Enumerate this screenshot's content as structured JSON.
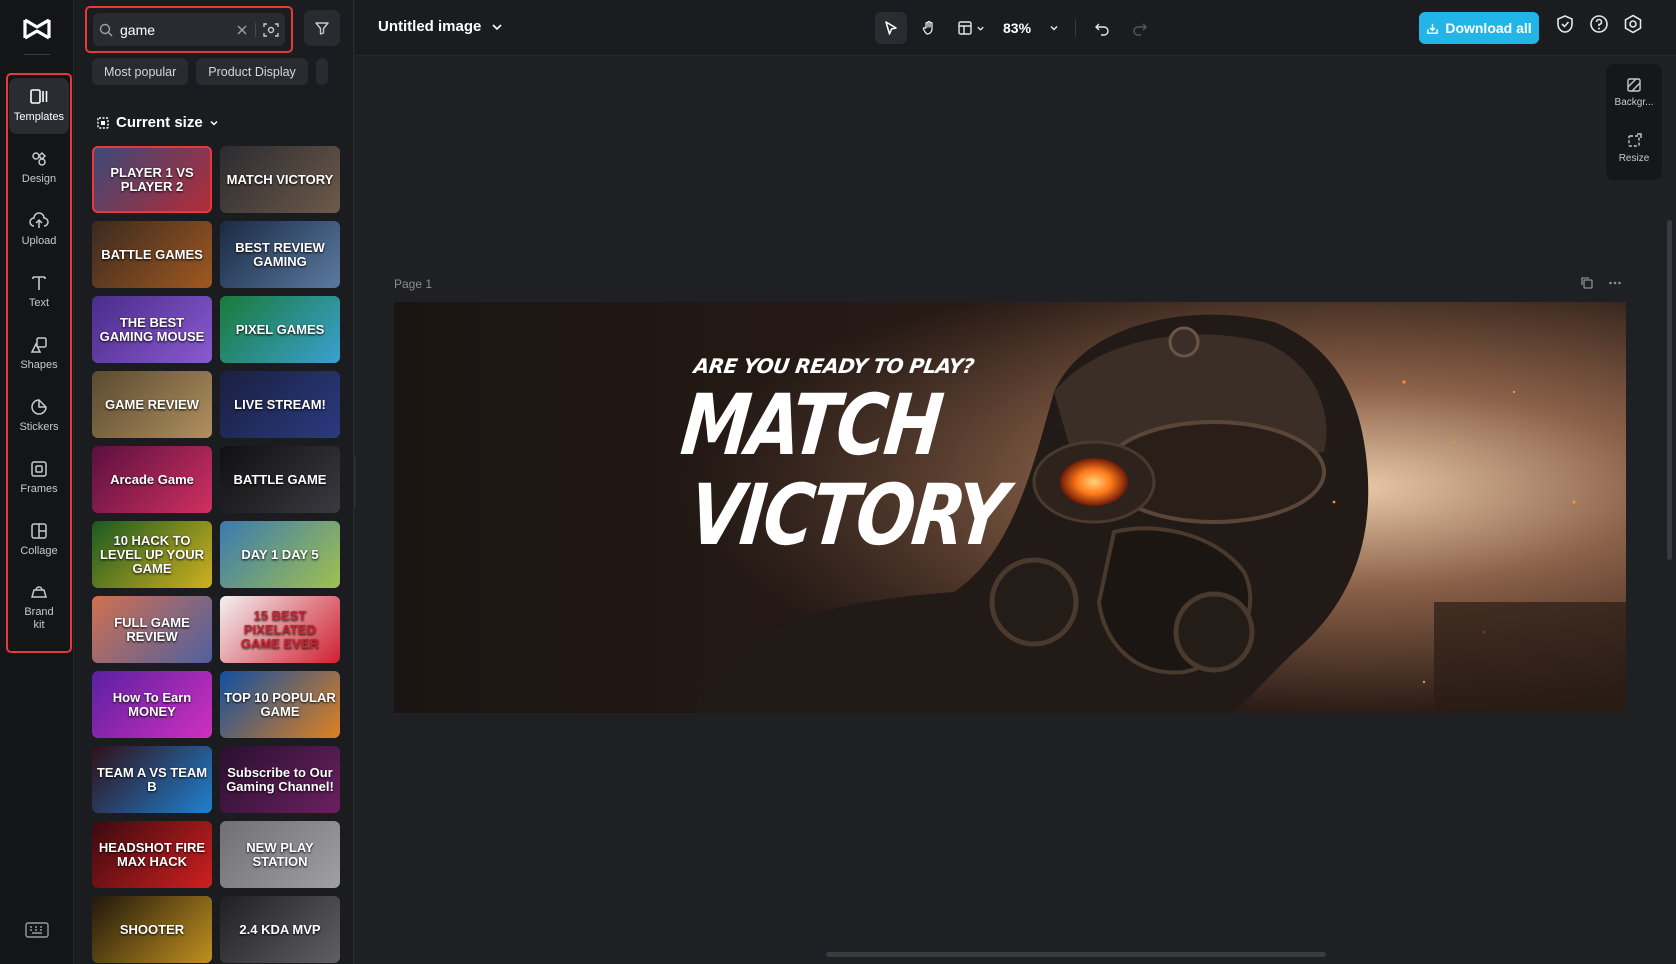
{
  "rail": {
    "items": [
      {
        "label": "Templates",
        "icon": "templates-icon"
      },
      {
        "label": "Design",
        "icon": "design-icon"
      },
      {
        "label": "Upload",
        "icon": "upload-icon"
      },
      {
        "label": "Text",
        "icon": "text-icon"
      },
      {
        "label": "Shapes",
        "icon": "shapes-icon"
      },
      {
        "label": "Stickers",
        "icon": "stickers-icon"
      },
      {
        "label": "Frames",
        "icon": "frames-icon"
      },
      {
        "label": "Collage",
        "icon": "collage-icon"
      },
      {
        "label": "Brand kit",
        "icon": "brand-kit-icon"
      }
    ]
  },
  "search": {
    "value": "game"
  },
  "chips": [
    "Most popular",
    "Product Display"
  ],
  "section_title": "Current size",
  "templates": [
    {
      "text": "PLAYER 1 VS PLAYER 2",
      "bg": "#3a4a7a",
      "bg2": "#b52a36"
    },
    {
      "text": "MATCH VICTORY",
      "bg": "#2a2b30",
      "bg2": "#6e5a4a"
    },
    {
      "text": "BATTLE GAMES",
      "bg": "#3a2a20",
      "bg2": "#a05820"
    },
    {
      "text": "BEST REVIEW GAMING",
      "bg": "#1a2a44",
      "bg2": "#5a7aa0"
    },
    {
      "text": "THE BEST GAMING MOUSE",
      "bg": "#4a2c8a",
      "bg2": "#8a5ad0"
    },
    {
      "text": "PIXEL GAMES",
      "bg": "#1a7a3a",
      "bg2": "#3aa0d0"
    },
    {
      "text": "GAME REVIEW",
      "bg": "#5a4a30",
      "bg2": "#b09060"
    },
    {
      "text": "LIVE STREAM!",
      "bg": "#1a2040",
      "bg2": "#2a3a80"
    },
    {
      "text": "Arcade Game",
      "bg": "#5a1040",
      "bg2": "#d03060"
    },
    {
      "text": "BATTLE GAME",
      "bg": "#101012",
      "bg2": "#3a3a40"
    },
    {
      "text": "10 HACK TO LEVEL UP YOUR GAME",
      "bg": "#1a5a20",
      "bg2": "#d0b020"
    },
    {
      "text": "DAY 1 DAY 5",
      "bg": "#3a7ab0",
      "bg2": "#a0c050"
    },
    {
      "text": "FULL GAME REVIEW",
      "bg": "#d07050",
      "bg2": "#5060a0"
    },
    {
      "text": "15 BEST PIXELATED GAME EVER",
      "bg": "#f2f2f2",
      "bg2": "#d02030"
    },
    {
      "text": "How To Earn MONEY",
      "bg": "#5a20a0",
      "bg2": "#d030c0"
    },
    {
      "text": "TOP 10 POPULAR GAME",
      "bg": "#1050a0",
      "bg2": "#e08020"
    },
    {
      "text": "TEAM A VS TEAM B",
      "bg": "#301018",
      "bg2": "#2080d0"
    },
    {
      "text": "Subscribe to Our Gaming Channel!",
      "bg": "#2a1030",
      "bg2": "#6a2060"
    },
    {
      "text": "HEADSHOT FIRE MAX HACK",
      "bg": "#3a0a10",
      "bg2": "#d02020"
    },
    {
      "text": "NEW PLAY STATION",
      "bg": "#707074",
      "bg2": "#a0a0a4"
    },
    {
      "text": "SHOOTER",
      "bg": "#20180c",
      "bg2": "#c09020"
    },
    {
      "text": "2.4 KDA MVP",
      "bg": "#202022",
      "bg2": "#606064"
    }
  ],
  "topbar": {
    "title": "Untitled image",
    "zoom": "83%",
    "download_label": "Download all"
  },
  "side_tools": [
    {
      "label": "Backgr...",
      "icon": "background-icon"
    },
    {
      "label": "Resize",
      "icon": "resize-icon"
    }
  ],
  "page": {
    "label": "Page 1",
    "headline_small": "ARE YOU READY TO PLAY?",
    "headline_1": "MATCH",
    "headline_2": "VICTORY"
  },
  "colors": {
    "accent": "#22b6e8",
    "highlight": "#e5393c"
  }
}
